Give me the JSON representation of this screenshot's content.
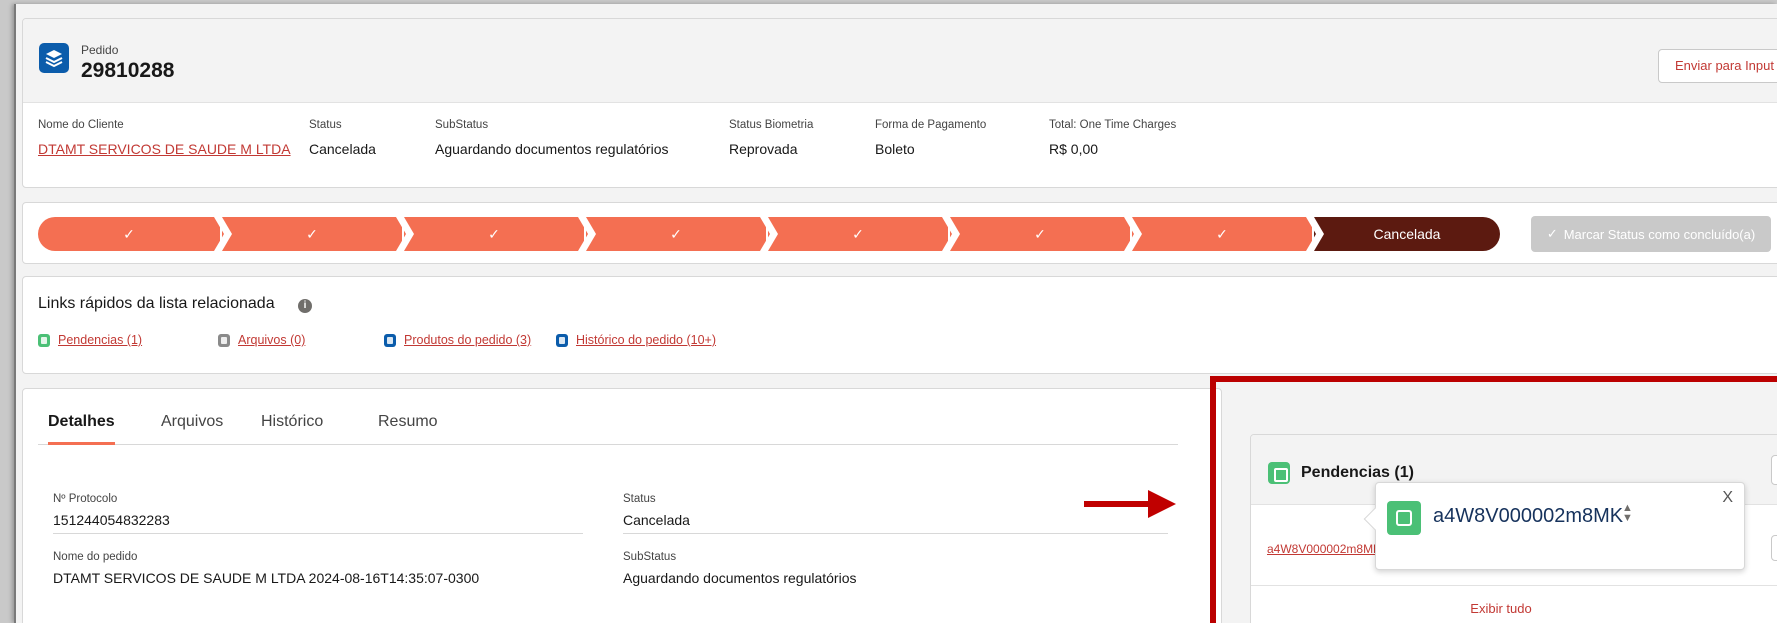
{
  "header": {
    "object_type": "Pedido",
    "record_number": "29810288",
    "action_button": "Enviar para Input",
    "fields": [
      {
        "label": "Nome do Cliente",
        "value": "DTAMT SERVICOS DE SAUDE M LTDA"
      },
      {
        "label": "Status",
        "value": "Cancelada"
      },
      {
        "label": "SubStatus",
        "value": "Aguardando documentos regulatórios"
      },
      {
        "label": "Status Biometria",
        "value": "Reprovada"
      },
      {
        "label": "Forma de Pagamento",
        "value": "Boleto"
      },
      {
        "label": "Total: One Time Charges",
        "value": "R$ 0,00"
      }
    ]
  },
  "path": {
    "completed_mark": "✓",
    "current_stage": "Cancelada",
    "mark_complete_button": "Marcar Status como concluído(a)",
    "colors": {
      "completed": "#f46f52",
      "current": "#5c1a10",
      "disabled": "#c9c9c9"
    }
  },
  "quick_links": {
    "title": "Links rápidos da lista relacionada",
    "info_icon": "i",
    "links": [
      {
        "label": "Pendencias (1)",
        "icon": "pendencias-icon",
        "color": "#4bc076"
      },
      {
        "label": "Arquivos (0)",
        "icon": "file-icon",
        "color": "#8a8a8a"
      },
      {
        "label": "Produtos do pedido (3)",
        "icon": "products-icon",
        "color": "#0b5cab"
      },
      {
        "label": "Histórico do pedido (10+)",
        "icon": "history-icon",
        "color": "#0b5cab"
      }
    ]
  },
  "details": {
    "tabs": [
      "Detalhes",
      "Arquivos",
      "Histórico",
      "Resumo"
    ],
    "fields_left": [
      {
        "label": "Nº Protocolo",
        "value": "151244054832283"
      },
      {
        "label": "Nome do pedido",
        "value": "DTAMT SERVICOS DE SAUDE M LTDA 2024-08-16T14:35:07-0300"
      }
    ],
    "fields_right": [
      {
        "label": "Status",
        "value": "Cancelada"
      },
      {
        "label": "SubStatus",
        "value": "Aguardando documentos regulatórios"
      }
    ]
  },
  "related": {
    "title": "Pendencias (1)",
    "record": "a4W8V000002m8MK",
    "view_all": "Exibir tudo"
  },
  "popover": {
    "title": "a4W8V000002m8MK",
    "sort_glyph": "▲▼",
    "close": "X"
  },
  "colors": {
    "accent": "#c23934",
    "highlight_border": "#bb0000",
    "arrow": "#c00000"
  }
}
